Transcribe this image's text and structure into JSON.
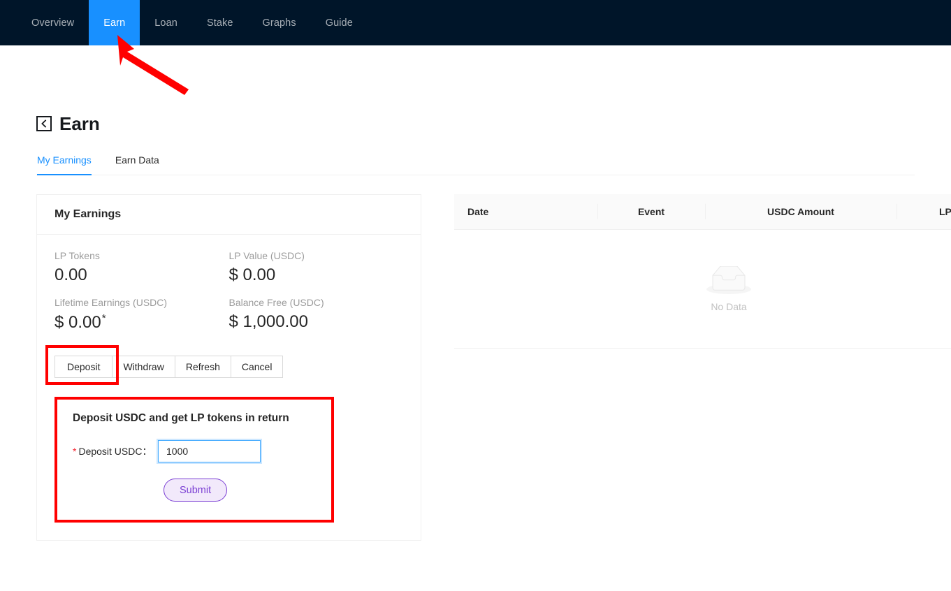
{
  "nav": {
    "items": [
      {
        "label": "Overview",
        "active": false
      },
      {
        "label": "Earn",
        "active": true
      },
      {
        "label": "Loan",
        "active": false
      },
      {
        "label": "Stake",
        "active": false
      },
      {
        "label": "Graphs",
        "active": false
      },
      {
        "label": "Guide",
        "active": false
      }
    ],
    "active_bg": "#1890ff",
    "bar_bg": "#001529"
  },
  "page": {
    "title": "Earn",
    "back_icon": "chevron-left-boxed-icon"
  },
  "tabs": [
    {
      "label": "My Earnings",
      "active": true
    },
    {
      "label": "Earn Data",
      "active": false
    }
  ],
  "card": {
    "title": "My Earnings",
    "stats": [
      {
        "label": "LP Tokens",
        "value": "0.00",
        "note": ""
      },
      {
        "label": "LP Value (USDC)",
        "value": "$ 0.00",
        "note": ""
      },
      {
        "label": "Lifetime Earnings (USDC)",
        "value": "$ 0.00",
        "note": "*"
      },
      {
        "label": "Balance Free (USDC)",
        "value": "$ 1,000.00",
        "note": ""
      }
    ],
    "buttons": [
      {
        "label": "Deposit",
        "highlighted": true
      },
      {
        "label": "Withdraw",
        "highlighted": false
      },
      {
        "label": "Refresh",
        "highlighted": false
      },
      {
        "label": "Cancel",
        "highlighted": false
      }
    ]
  },
  "deposit_form": {
    "title": "Deposit USDC and get LP tokens in return",
    "field_label": "Deposit USDC：",
    "required_marker": "*",
    "field_value": "1000",
    "field_placeholder": "",
    "submit_label": "Submit",
    "submit_color": "#7b3fd4",
    "submit_bg": "#f2e9fb"
  },
  "table": {
    "columns": [
      "Date",
      "Event",
      "USDC Amount",
      "LP A"
    ],
    "rows": [],
    "empty_text": "No Data",
    "empty_icon": "empty-inbox-icon"
  },
  "annotations": {
    "color": "#ff0000",
    "arrow": "red-arrow-pointing-to-earn-tab",
    "deposit_box": "red-box-around-deposit-button",
    "form_box": "red-box-around-deposit-form"
  }
}
